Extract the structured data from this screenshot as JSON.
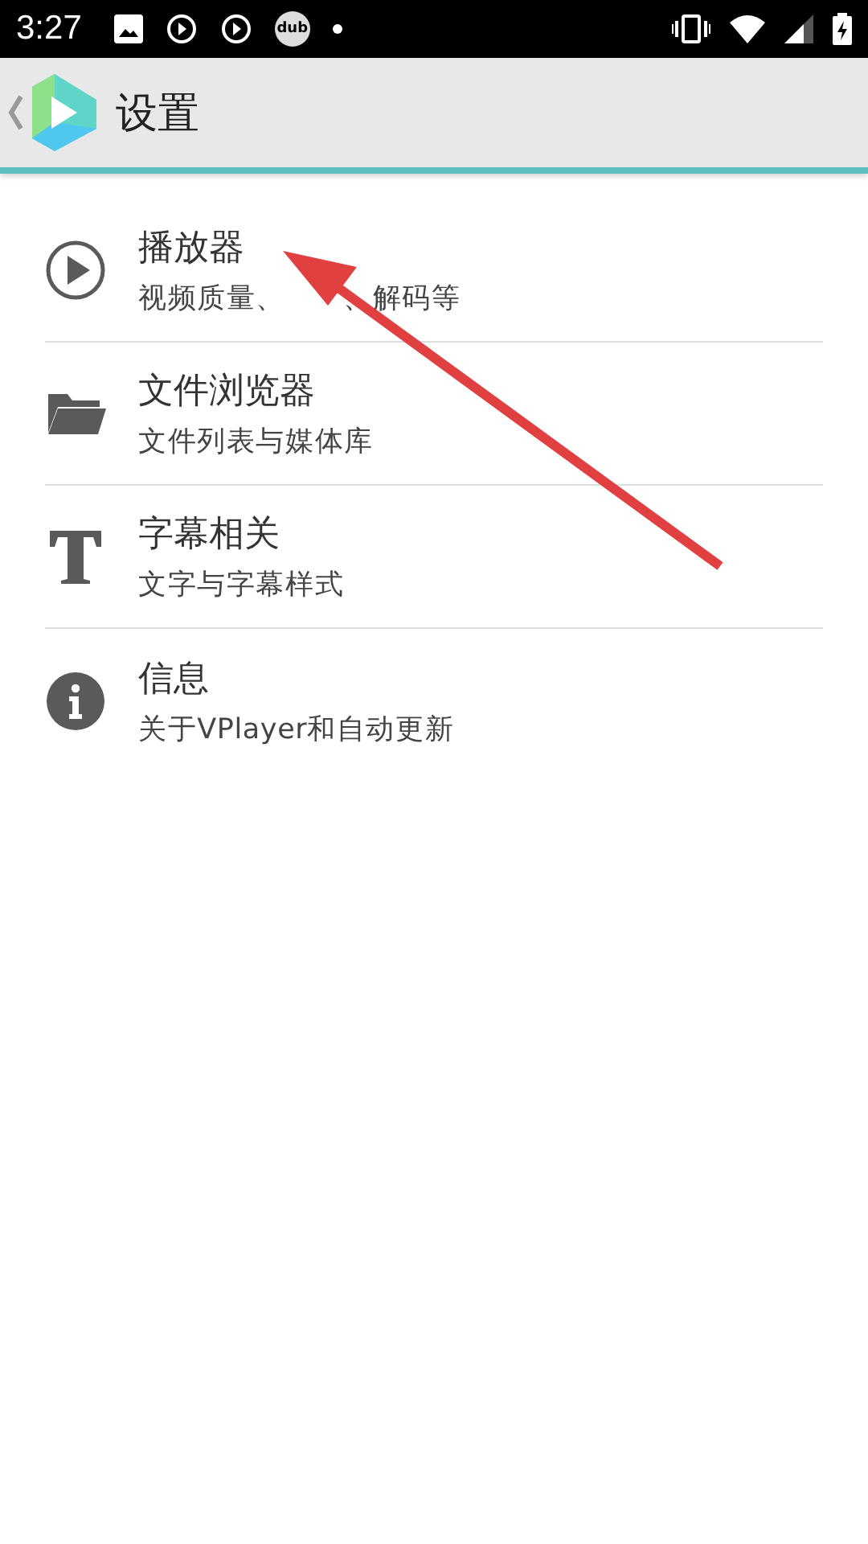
{
  "status_bar": {
    "time": "3:27",
    "badge": "dub"
  },
  "toolbar": {
    "title": "设置"
  },
  "items": [
    {
      "kind": "play",
      "title": "播放器",
      "subtitle_parts": [
        "视频质量、",
        "、解码等"
      ]
    },
    {
      "kind": "folder",
      "title": "文件浏览器",
      "subtitle": "文件列表与媒体库"
    },
    {
      "kind": "text",
      "title": "字幕相关",
      "subtitle": "文字与字幕样式"
    },
    {
      "kind": "info",
      "title": "信息",
      "subtitle": "关于VPlayer和自动更新"
    }
  ]
}
